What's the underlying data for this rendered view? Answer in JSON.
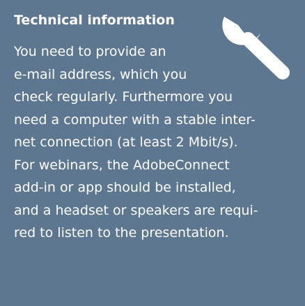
{
  "panel": {
    "title": "Technical information",
    "icon": "wrench-icon",
    "background_color": "#5e7791",
    "text_color": "#ffffff",
    "body_lines": [
      "You need to provide an",
      "e-mail address, which you",
      "check regularly. Furthermore you",
      "need a computer with a stable inter-",
      "net connection (at least 2 Mbit/s).",
      "For webinars, the AdobeConnect",
      "add-in or app should be installed,",
      "and a headset or speakers are requi-",
      "red to listen to the presentation."
    ]
  }
}
